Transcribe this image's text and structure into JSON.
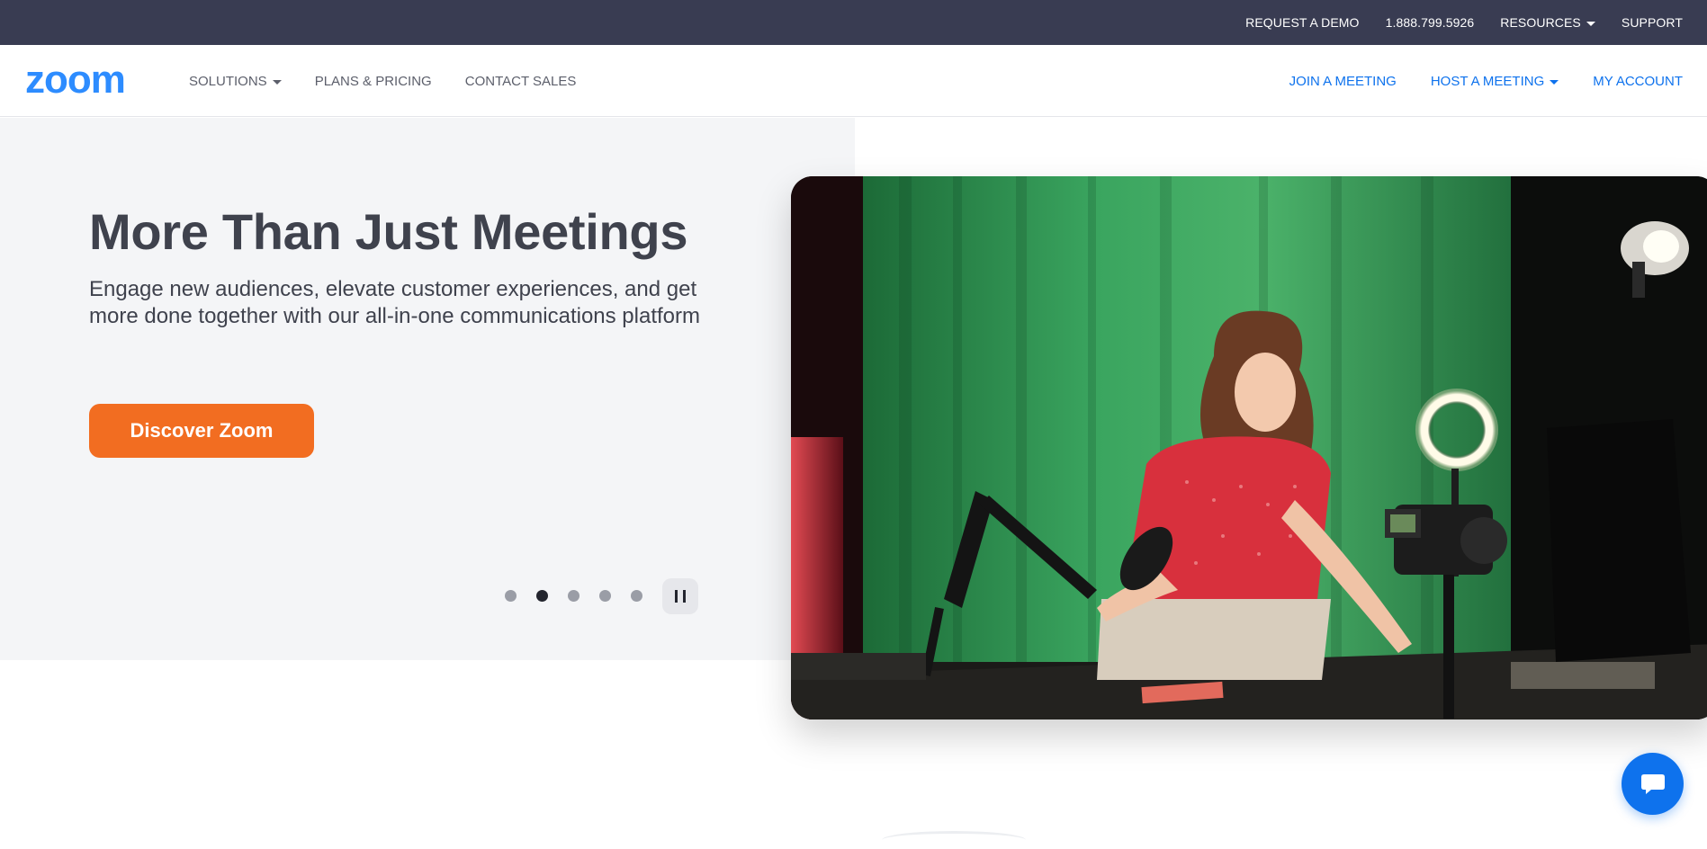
{
  "colors": {
    "topbar": "#393c52",
    "brand_blue": "#0e72ed",
    "cta_orange": "#f26d21",
    "hero_bg": "#f4f5f7",
    "text_dark": "#3f424d"
  },
  "topbar": {
    "request_demo": "REQUEST A DEMO",
    "phone": "1.888.799.5926",
    "resources": "RESOURCES",
    "support": "SUPPORT"
  },
  "nav": {
    "logo_text": "zoom",
    "solutions": "SOLUTIONS",
    "plans_pricing": "PLANS & PRICING",
    "contact_sales": "CONTACT SALES",
    "join_meeting": "JOIN A MEETING",
    "host_meeting": "HOST A MEETING",
    "my_account": "MY ACCOUNT"
  },
  "hero": {
    "title": "More Than Just Meetings",
    "subtitle": "Engage new audiences, elevate customer experiences, and get more done together with our all-in-one communications platform",
    "cta_label": "Discover Zoom",
    "carousel": {
      "slide_count": 5,
      "active_index": 1
    }
  },
  "icons": {
    "resources_caret": "chevron-down-icon",
    "pause": "pause-icon",
    "chat": "chat-bubble-icon"
  }
}
